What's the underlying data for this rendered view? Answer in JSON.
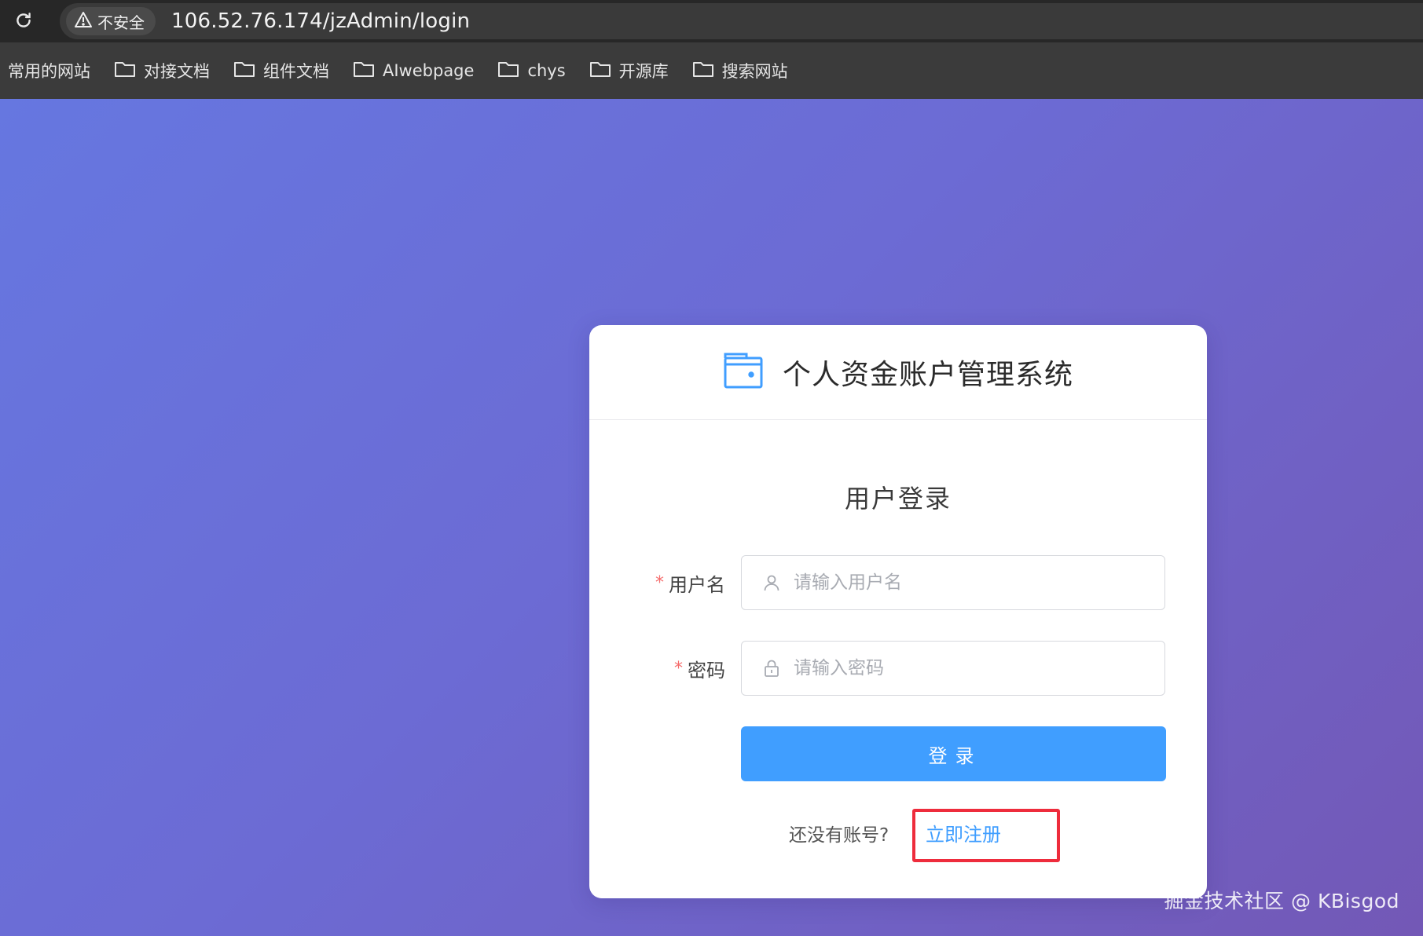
{
  "browser": {
    "security_label": "不安全",
    "url": "106.52.76.174/jzAdmin/login",
    "bookmarks": [
      {
        "label": "常用的网站",
        "icon": "none"
      },
      {
        "label": "对接文档",
        "icon": "folder-icon"
      },
      {
        "label": "组件文档",
        "icon": "folder-icon"
      },
      {
        "label": "AIwebpage",
        "icon": "folder-icon"
      },
      {
        "label": "chys",
        "icon": "folder-icon"
      },
      {
        "label": "开源库",
        "icon": "folder-icon"
      },
      {
        "label": "搜索网站",
        "icon": "folder-icon"
      }
    ]
  },
  "card": {
    "system_title": "个人资金账户管理系统",
    "login_title": "用户登录",
    "username": {
      "label": "用户名",
      "required_mark": "*",
      "placeholder": "请输入用户名",
      "value": ""
    },
    "password": {
      "label": "密码",
      "required_mark": "*",
      "placeholder": "请输入密码",
      "value": ""
    },
    "login_button": "登录",
    "no_account_text": "还没有账号?",
    "register_link": "立即注册"
  },
  "watermark": "掘金技术社区 @ KBisgod",
  "colors": {
    "accent": "#409eff",
    "required": "#f56c6c",
    "highlight": "#ee2c3c",
    "gradient_start": "#6677e0",
    "gradient_end": "#7358b6"
  }
}
